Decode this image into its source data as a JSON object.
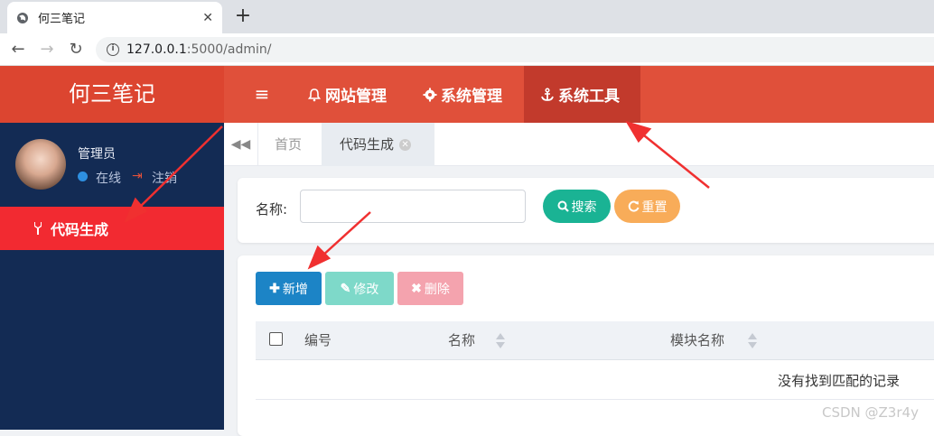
{
  "browser": {
    "tab_title": "何三笔记",
    "tab_close": "✕",
    "new_tab": "+",
    "url_host": "127.0.0.1",
    "url_rest": ":5000/admin/",
    "back": "←",
    "forward": "→",
    "reload": "↻"
  },
  "header": {
    "logo": "何三笔记",
    "menu_toggle": "≡",
    "menus": [
      {
        "icon": "bell-icon",
        "label": "网站管理"
      },
      {
        "icon": "gear-icon",
        "label": "系统管理"
      },
      {
        "icon": "anchor-icon",
        "label": "系统工具"
      }
    ]
  },
  "sidebar": {
    "user_name": "管理员",
    "status": "在线",
    "logout": "注销",
    "items": [
      {
        "label": "代码生成",
        "icon": "wrench-icon"
      }
    ]
  },
  "tabs": {
    "home": "首页",
    "active": "代码生成"
  },
  "search": {
    "label": "名称:",
    "value": "",
    "search_btn": "搜索",
    "reset_btn": "重置"
  },
  "toolbar": {
    "add": "新增",
    "edit": "修改",
    "delete": "删除"
  },
  "table": {
    "columns": [
      "编号",
      "名称",
      "模块名称"
    ],
    "empty_text": "没有找到匹配的记录"
  },
  "watermark": "CSDN @Z3r4y",
  "colors": {
    "header": "#e0503a",
    "sidebar": "#132b54",
    "active_side": "#f22a31",
    "search": "#1ab394",
    "reset": "#f8ac59",
    "add": "#1c84c6"
  }
}
